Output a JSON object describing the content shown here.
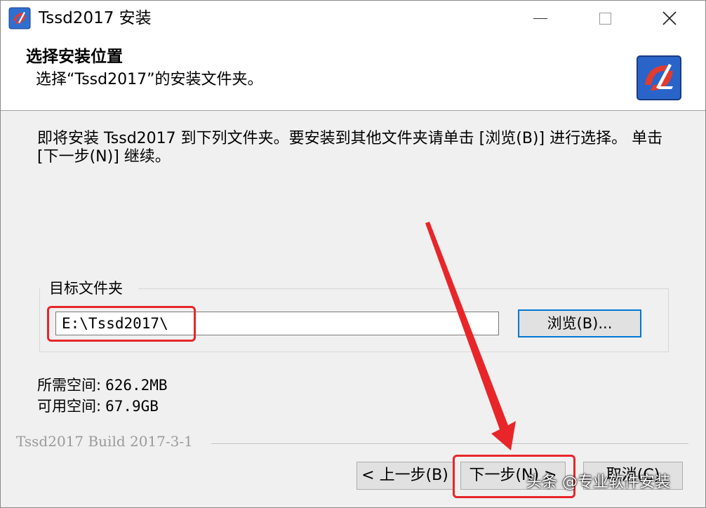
{
  "window": {
    "title": "Tssd2017 安装",
    "icon": "tssd-app-icon"
  },
  "header": {
    "title": "选择安装位置",
    "subtitle": "选择“Tssd2017”的安装文件夹。",
    "logo_icon": "tssd-logo-icon"
  },
  "body": {
    "intro": "即将安装 Tssd2017 到下列文件夹。要安装到其他文件夹请单击 [浏览(B)] 进行选择。 单击 [下一步(N)] 继续。",
    "group_label": "目标文件夹",
    "path_value": "E:\\Tssd2017\\",
    "browse_label": "浏览(B)...",
    "required_label": "所需空间:",
    "required_value": "626.2MB",
    "available_label": "可用空间:",
    "available_value": "67.9GB"
  },
  "footer": {
    "build": "Tssd2017 Build 2017-3-1",
    "back_label": "< 上一步(B)",
    "next_label": "下一步(N) >",
    "cancel_label": "取消(C)"
  },
  "overlay": {
    "watermark": "头条 @专业软件安装",
    "highlight_color": "#e8262a"
  },
  "colors": {
    "accent": "#0078d7",
    "header_bg": "#ffffff",
    "dialog_bg": "#f0f0f0"
  }
}
